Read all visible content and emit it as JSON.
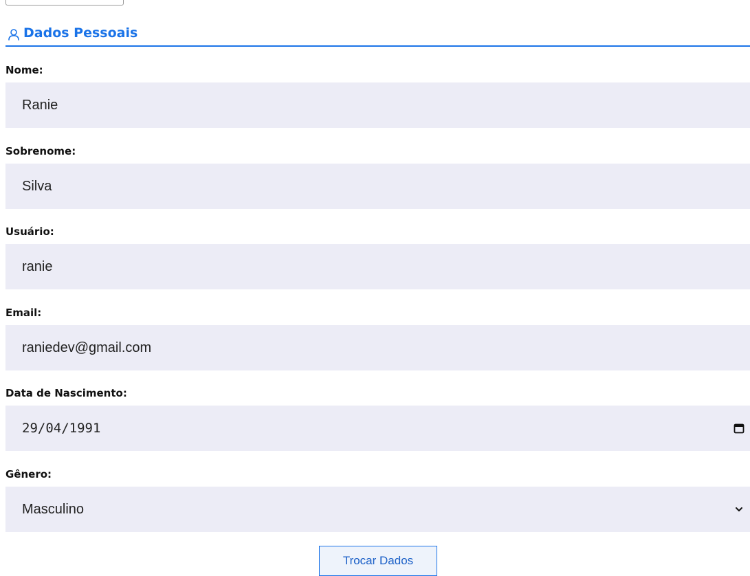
{
  "section": {
    "title": "Dados Pessoais",
    "icon": "user-icon",
    "accent_color": "#1a73e8"
  },
  "fields": {
    "nome": {
      "label": "Nome:",
      "value": "Ranie"
    },
    "sobrenome": {
      "label": "Sobrenome:",
      "value": "Silva"
    },
    "usuario": {
      "label": "Usuário:",
      "value": "ranie"
    },
    "email": {
      "label": "Email:",
      "value": "raniedev@gmail.com"
    },
    "nascimento": {
      "label": "Data de Nascimento:",
      "value": "29/04/1991",
      "icon": "calendar-icon"
    },
    "genero": {
      "label": "Gênero:",
      "value": "Masculino",
      "icon": "chevron-down-icon"
    }
  },
  "actions": {
    "submit_label": "Trocar Dados"
  },
  "colors": {
    "field_background": "#ececf6",
    "accent": "#1a73e8"
  }
}
